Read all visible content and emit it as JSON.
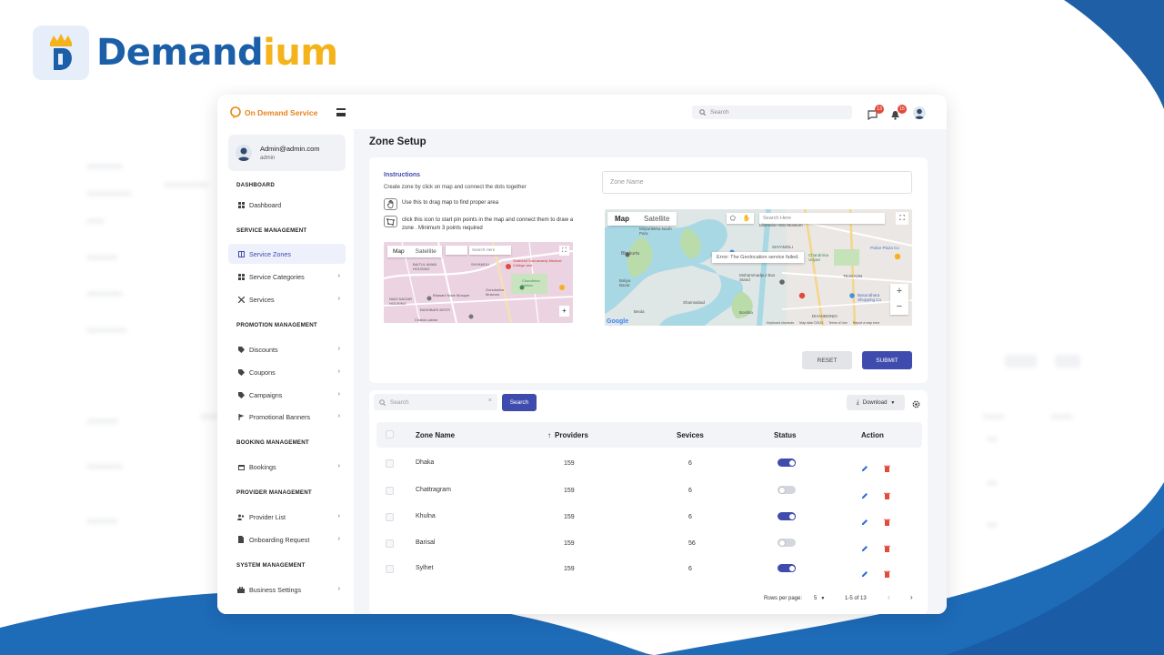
{
  "brand": {
    "name_part1": "Demand",
    "name_part2": "ium"
  },
  "app": {
    "logo_text": "On Demand Service"
  },
  "profile": {
    "email": "Admin@admin.com",
    "role": "admin"
  },
  "sidebar": {
    "sections": [
      {
        "title": "DASHBOARD",
        "items": [
          {
            "label": "Dashboard",
            "icon": "dashboard-icon"
          }
        ]
      },
      {
        "title": "SERVICE MANAGEMENT",
        "items": [
          {
            "label": "Service Zones",
            "icon": "map-icon",
            "active": true
          },
          {
            "label": "Service Categories",
            "icon": "grid-icon"
          },
          {
            "label": "Services",
            "icon": "tools-icon"
          }
        ]
      },
      {
        "title": "PROMOTION MANAGEMENT",
        "items": [
          {
            "label": "Discounts",
            "icon": "tag-icon"
          },
          {
            "label": "Coupons",
            "icon": "tag-icon"
          },
          {
            "label": "Campaigns",
            "icon": "tag-icon"
          },
          {
            "label": "Promotional Banners",
            "icon": "flag-icon"
          }
        ]
      },
      {
        "title": "BOOKING MANAGEMENT",
        "items": [
          {
            "label": "Bookings",
            "icon": "calendar-icon"
          }
        ]
      },
      {
        "title": "PROVIDER MANAGEMENT",
        "items": [
          {
            "label": "Provider List",
            "icon": "users-icon"
          },
          {
            "label": "Onboarding Request",
            "icon": "document-icon"
          }
        ]
      },
      {
        "title": "SYSTEM MANAGEMENT",
        "items": [
          {
            "label": "Business Settings",
            "icon": "briefcase-icon"
          }
        ]
      }
    ]
  },
  "topbar": {
    "search_placeholder": "Search",
    "chat_badge": "13",
    "notification_badge": "15"
  },
  "page": {
    "title": "Zone Setup"
  },
  "instructions": {
    "title": "Instructions",
    "description": "Create zone by click on map and connect the dots together",
    "step1": "Use this to drag map to find proper area",
    "step2": "click this icon to start pin points in the map and connect them to draw a zone . Minimum 3  points required"
  },
  "mini_map": {
    "tab_map": "Map",
    "tab_satellite": "Satellite",
    "search_placeholder": "Search Here",
    "labels": [
      "BAITUL AMAN HOUSING",
      "SHYAMOLI",
      "Shaheed Suhrawardy Medical College and",
      "Chandrima Uddan",
      "Bhasani Nove Mosque",
      "NADI NAGAR HOUSING",
      "Gonotontra Museum",
      "BASHBARI BOSTI",
      "Chalda Labba"
    ]
  },
  "zone_form": {
    "zone_name_placeholder": "Zone Name",
    "map_tab_map": "Map",
    "map_tab_satellite": "Satellite",
    "map_search_placeholder": "Search Here",
    "map_error": "Error: The Geolocation service failed.",
    "map_labels": [
      "Mirpurlekha North Para",
      "Bhakurta",
      "Liberation War Museum",
      "SHYAMOLI",
      "Chandrima Udyan",
      "Police Plaza Co",
      "TEJGAON",
      "Mohammadpur Bus Stand",
      "Basundhara Shopping Co",
      "Shamsabad",
      "Baliya Bazar",
      "Beula",
      "Boshila",
      "DHANMONDI"
    ],
    "map_footer": [
      "Google",
      "Keyboard shortcuts",
      "Map data ©2023",
      "Terms of Use",
      "Report a map error"
    ],
    "reset_label": "RESET",
    "submit_label": "SUBMIT"
  },
  "table": {
    "search_placeholder": "Search",
    "search_button": "Search",
    "download_label": "Download",
    "columns": [
      "Zone Name",
      "Providers",
      "Sevices",
      "Status",
      "Action"
    ],
    "rows": [
      {
        "zone": "Dhaka",
        "providers": "159",
        "services": "6",
        "status": true
      },
      {
        "zone": "Chattragram",
        "providers": "159",
        "services": "6",
        "status": false
      },
      {
        "zone": "Khulna",
        "providers": "159",
        "services": "6",
        "status": true
      },
      {
        "zone": "Barisal",
        "providers": "159",
        "services": "56",
        "status": false
      },
      {
        "zone": "Sylhet",
        "providers": "159",
        "services": "6",
        "status": true
      }
    ],
    "pagination": {
      "rows_per_page_label": "Rows per page:",
      "rows_per_page": "5",
      "range": "1-5 of 13"
    }
  },
  "colors": {
    "accent": "#3f4cad",
    "brand_blue": "#1b5fa8",
    "brand_yellow": "#f5b31b",
    "logo_orange": "#e8821a",
    "badge_red": "#e34a3c"
  }
}
